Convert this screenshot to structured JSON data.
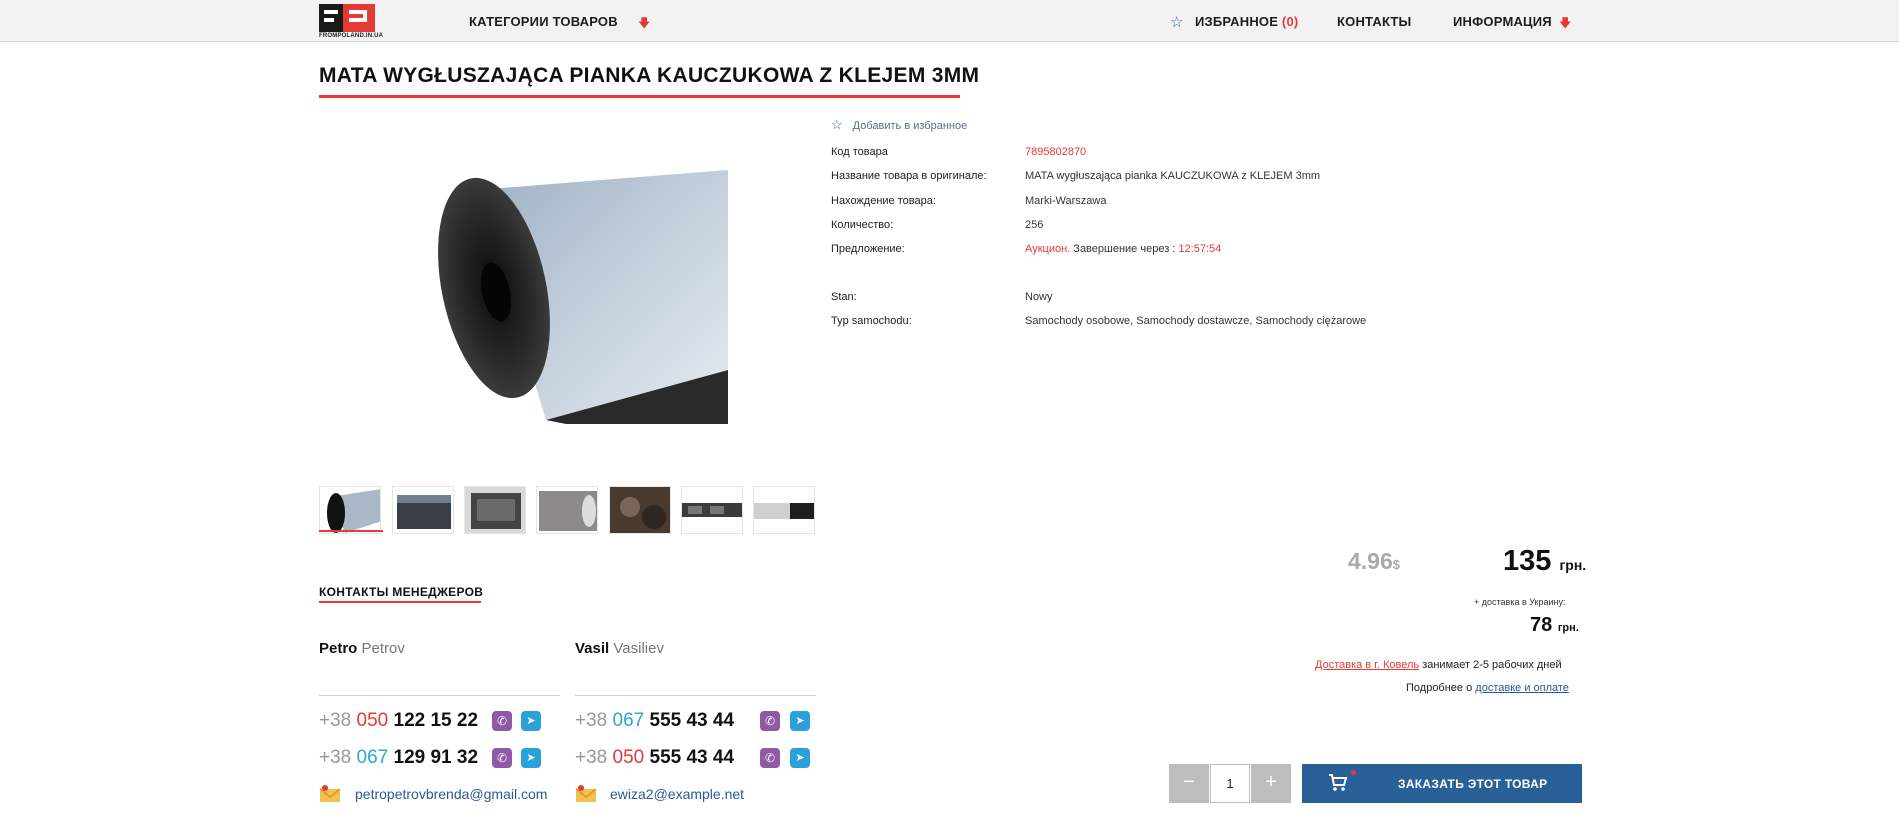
{
  "header": {
    "logo_text": "FROMPOLAND.IN.UA",
    "categories_label": "КАТЕГОРИИ ТОВАРОВ",
    "favorites_label": "ИЗБРАННОЕ",
    "favorites_count": "(0)",
    "contacts_label": "КОНТАКТЫ",
    "info_label": "ИНФОРМАЦИЯ"
  },
  "product": {
    "title": "MATA WYGŁUSZAJĄCA PIANKA KAUCZUKOWA Z KLEJEM 3MM",
    "add_favorite": "Добавить в избранное",
    "details": [
      {
        "label": "Код товара",
        "value": "7895802870"
      },
      {
        "label": "Название товара в оригинале:",
        "value": "MATA wygłuszająca pianka KAUCZUKOWA z KLEJEM 3mm"
      },
      {
        "label": "Нахождение товара:",
        "value": "Marki-Warszawa"
      },
      {
        "label": "Количество:",
        "value": "256"
      }
    ],
    "offer_label": "Предложение:",
    "offer_type": "Аукцион.",
    "offer_end_text": "Завершение через :",
    "offer_timer": "12:57:54",
    "params": [
      {
        "label": "Stan:",
        "value": "Nowy"
      },
      {
        "label": "Typ samochodu:",
        "value": "Samochody osobowe, Samochody dostawcze, Samochody ciężarowe"
      }
    ]
  },
  "managers": {
    "title": "КОНТАКТЫ МЕНЕДЖЕРОВ",
    "list": [
      {
        "first": "Petro",
        "last": "Petrov",
        "phones": [
          {
            "cc": "+38",
            "op": "050",
            "num": "122 15 22"
          },
          {
            "cc": "+38",
            "op": "067",
            "num": "129 91 32"
          }
        ],
        "email": "petropetrovbrenda@gmail.com"
      },
      {
        "first": "Vasil",
        "last": "Vasiliev",
        "phones": [
          {
            "cc": "+38",
            "op": "067",
            "num": "555 43 44"
          },
          {
            "cc": "+38",
            "op": "050",
            "num": "555 43 44"
          }
        ],
        "email": "ewiza2@example.net"
      }
    ]
  },
  "pricing": {
    "usd": "4.96",
    "usd_sign": "$",
    "uah": "135",
    "uah_unit": "грн.",
    "delivery_note": "+ доставка в Украину:",
    "delivery_price": "78",
    "delivery_unit": "грн.",
    "delivery_link": "Доставка в г. Ковель",
    "delivery_text": "занимает 2-5 рабочих дней",
    "more_text": "Подробнее о",
    "more_link": "доставке и оплате"
  },
  "order": {
    "quantity": "1",
    "minus": "−",
    "plus": "+",
    "button_label": "ЗАКАЗАТЬ ЭТОТ ТОВАР"
  }
}
